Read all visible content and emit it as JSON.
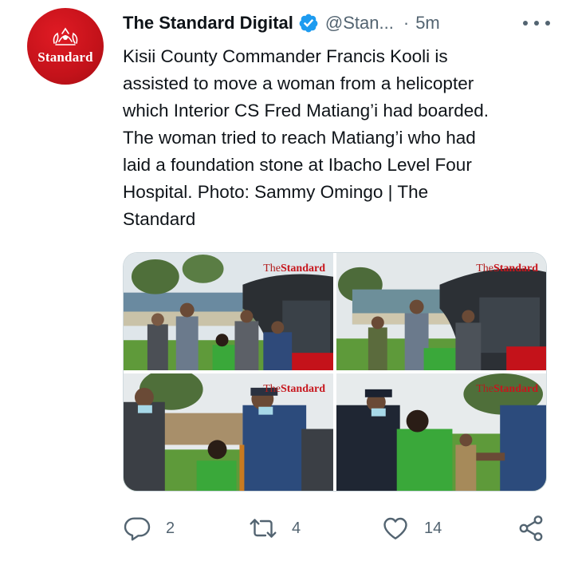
{
  "account": {
    "avatar_text": "Standard",
    "display_name": "The Standard Digital",
    "handle": "@Stan...",
    "separator": "·",
    "time": "5m"
  },
  "tweet": {
    "text": "Kisii County Commander Francis Kooli is\nassisted to move a woman from a helicopter\nwhich Interior CS Fred Matiang’i had boarded.\nThe woman tried to reach Matiang’i who had\nlaid a foundation stone at Ibacho Level Four\nHospital. Photo: Sammy Omingo | The\nStandard"
  },
  "media": {
    "watermark_the": "The",
    "watermark_standard": "Standard",
    "photos": [
      "photo-1",
      "photo-2",
      "photo-3",
      "photo-4"
    ]
  },
  "actions": {
    "reply_count": "2",
    "retweet_count": "4",
    "like_count": "14"
  },
  "icons": {
    "reply": "reply-icon",
    "retweet": "retweet-icon",
    "like": "like-icon",
    "share": "share-icon",
    "verified": "verified-badge-icon",
    "more": "more-options-icon"
  },
  "colors": {
    "text": "#0f1419",
    "secondary": "#536471",
    "verified": "#1d9bf0",
    "brand_red": "#c4121a"
  }
}
